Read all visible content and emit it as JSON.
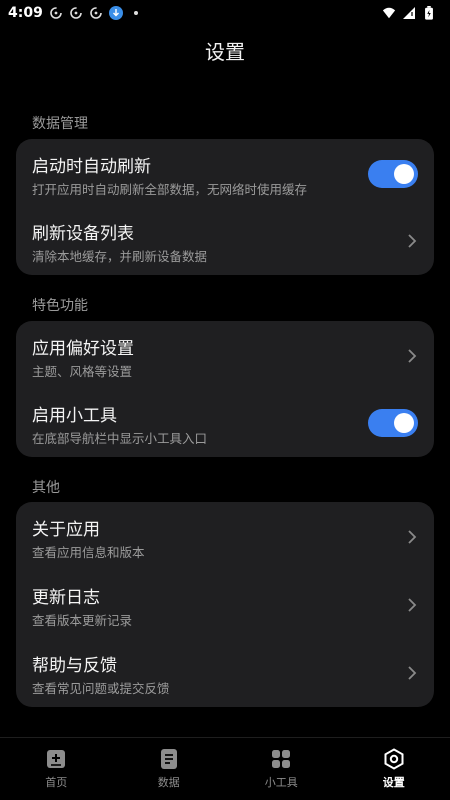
{
  "status_bar": {
    "time": "4:09"
  },
  "header": {
    "title": "设置"
  },
  "sections": [
    {
      "label": "数据管理",
      "items": [
        {
          "title": "启动时自动刷新",
          "subtitle": "打开应用时自动刷新全部数据，无网络时使用缓存",
          "control": "toggle",
          "on": true
        },
        {
          "title": "刷新设备列表",
          "subtitle": "清除本地缓存，并刷新设备数据",
          "control": "chevron"
        }
      ]
    },
    {
      "label": "特色功能",
      "items": [
        {
          "title": "应用偏好设置",
          "subtitle": "主题、风格等设置",
          "control": "chevron"
        },
        {
          "title": "启用小工具",
          "subtitle": "在底部导航栏中显示小工具入口",
          "control": "toggle",
          "on": true
        }
      ]
    },
    {
      "label": "其他",
      "items": [
        {
          "title": "关于应用",
          "subtitle": "查看应用信息和版本",
          "control": "chevron"
        },
        {
          "title": "更新日志",
          "subtitle": "查看版本更新记录",
          "control": "chevron"
        },
        {
          "title": "帮助与反馈",
          "subtitle": "查看常见问题或提交反馈",
          "control": "chevron"
        }
      ]
    }
  ],
  "bottom_nav": {
    "items": [
      {
        "label": "首页",
        "icon": "home-plus-icon",
        "active": false
      },
      {
        "label": "数据",
        "icon": "document-icon",
        "active": false
      },
      {
        "label": "小工具",
        "icon": "grid-icon",
        "active": false
      },
      {
        "label": "设置",
        "icon": "settings-hexagon-icon",
        "active": true
      }
    ]
  },
  "colors": {
    "accent": "#3a7ff0",
    "card": "#1f1f21",
    "background": "#000000"
  }
}
